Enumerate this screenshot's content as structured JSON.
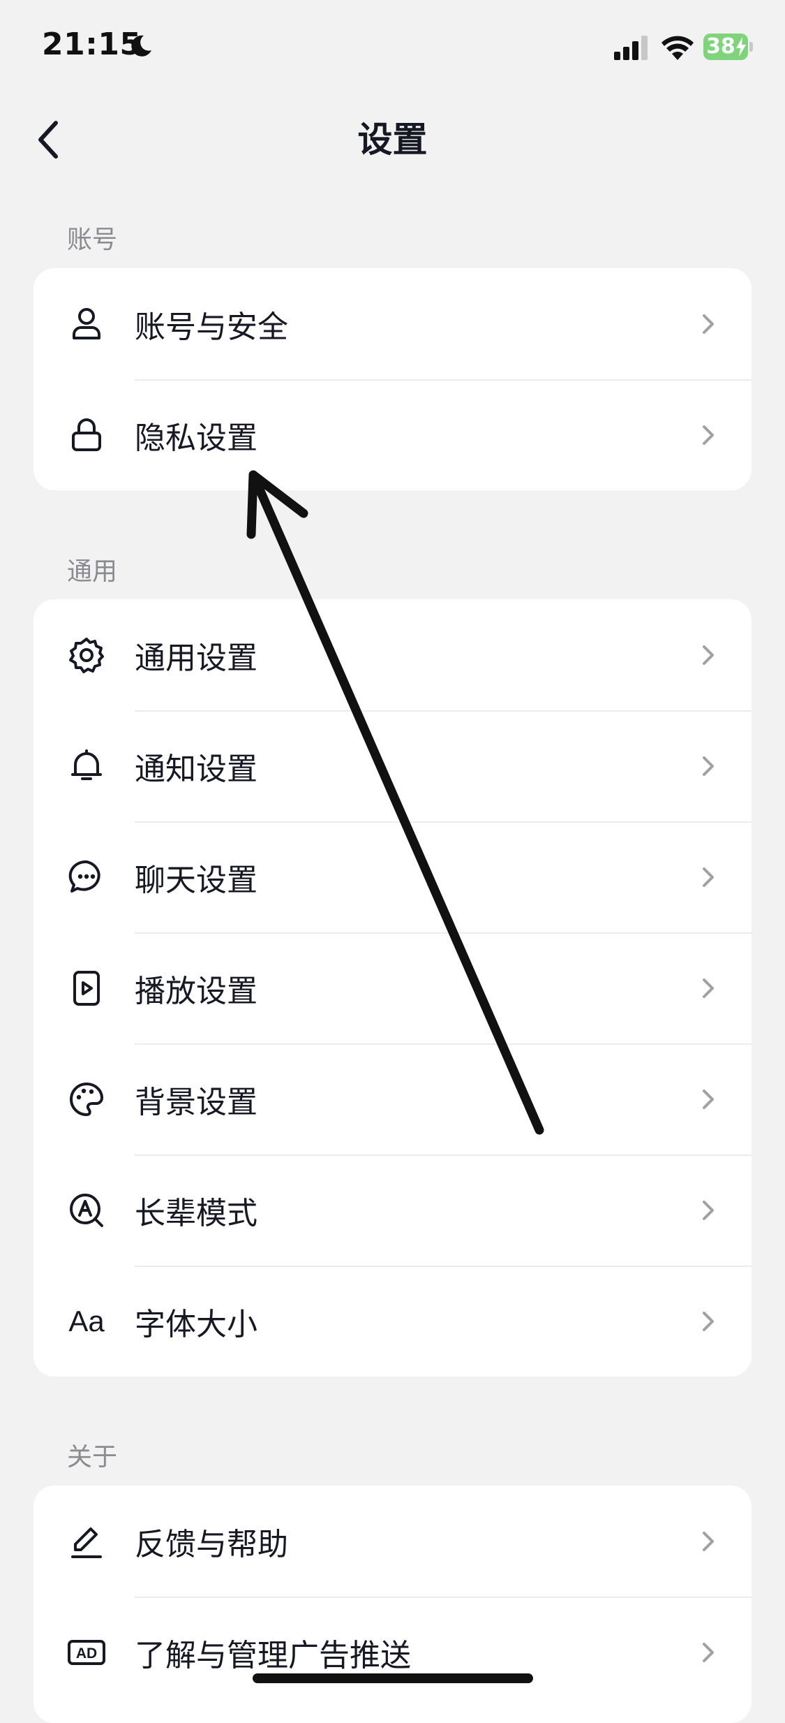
{
  "status_bar": {
    "time": "21:15",
    "battery": "38"
  },
  "nav": {
    "title": "设置"
  },
  "sections": [
    {
      "label": "账号",
      "items": [
        {
          "label": "账号与安全",
          "icon": "user-icon"
        },
        {
          "label": "隐私设置",
          "icon": "lock-icon"
        }
      ]
    },
    {
      "label": "通用",
      "items": [
        {
          "label": "通用设置",
          "icon": "gear-icon"
        },
        {
          "label": "通知设置",
          "icon": "bell-icon"
        },
        {
          "label": "聊天设置",
          "icon": "chat-bubble-icon"
        },
        {
          "label": "播放设置",
          "icon": "play-icon"
        },
        {
          "label": "背景设置",
          "icon": "palette-icon"
        },
        {
          "label": "长辈模式",
          "icon": "elder-mode-icon"
        },
        {
          "label": "字体大小",
          "icon": "font-size-icon",
          "icon_text": "Aa"
        }
      ]
    },
    {
      "label": "关于",
      "items": [
        {
          "label": "反馈与帮助",
          "icon": "pencil-icon"
        },
        {
          "label": "了解与管理广告推送",
          "icon": "ad-icon",
          "icon_text": "AD"
        }
      ]
    }
  ],
  "colors": {
    "background": "#f2f2f2",
    "card": "#ffffff",
    "text": "#161823",
    "section_label": "#8a8b91",
    "chevron": "#a0a1a6",
    "battery": "#7fd37a",
    "annotation": "#111111"
  }
}
